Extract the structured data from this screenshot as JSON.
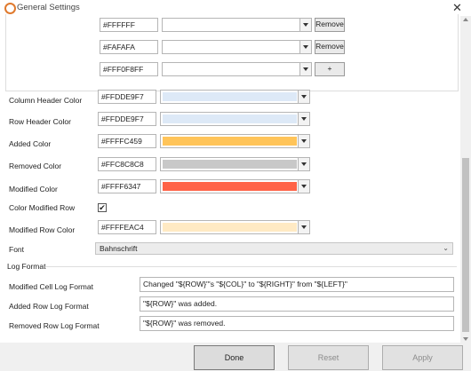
{
  "window": {
    "title": "General Settings",
    "accent_color": "#e07a2e"
  },
  "palette_rows": [
    {
      "value": "#FFFFFF",
      "button": "Remove"
    },
    {
      "value": "#FAFAFA",
      "button": "Remove"
    },
    {
      "value": "#FFF0F8FF",
      "button": "+"
    }
  ],
  "color_settings": [
    {
      "label": "Column Header Color",
      "value": "#FFDDE9F7",
      "swatch": "#dde9f7"
    },
    {
      "label": "Row Header Color",
      "value": "#FFDDE9F7",
      "swatch": "#dde9f7"
    },
    {
      "label": "Added Color",
      "value": "#FFFFC459",
      "swatch": "#ffc459"
    },
    {
      "label": "Removed Color",
      "value": "#FFC8C8C8",
      "swatch": "#c8c8c8"
    },
    {
      "label": "Modified Color",
      "value": "#FFFF6347",
      "swatch": "#ff6347"
    }
  ],
  "color_modified_row": {
    "label": "Color Modified Row",
    "checked": true,
    "mark": "✔"
  },
  "modified_row_color": {
    "label": "Modified Row Color",
    "value": "#FFFFEAC4",
    "swatch": "#ffeac4"
  },
  "font": {
    "label": "Font",
    "value": "Bahnschrift"
  },
  "log_format": {
    "group_title": "Log Format",
    "items": [
      {
        "label": "Modified Cell Log Format",
        "value": "Changed \"${ROW}\"'s \"${COL}\" to \"${RIGHT}\" from \"${LEFT}\""
      },
      {
        "label": "Added Row Log Format",
        "value": "\"${ROW}\" was added."
      },
      {
        "label": "Removed Row Log Format",
        "value": "\"${ROW}\" was removed."
      }
    ]
  },
  "footer": {
    "done": "Done",
    "reset": "Reset",
    "apply": "Apply"
  }
}
